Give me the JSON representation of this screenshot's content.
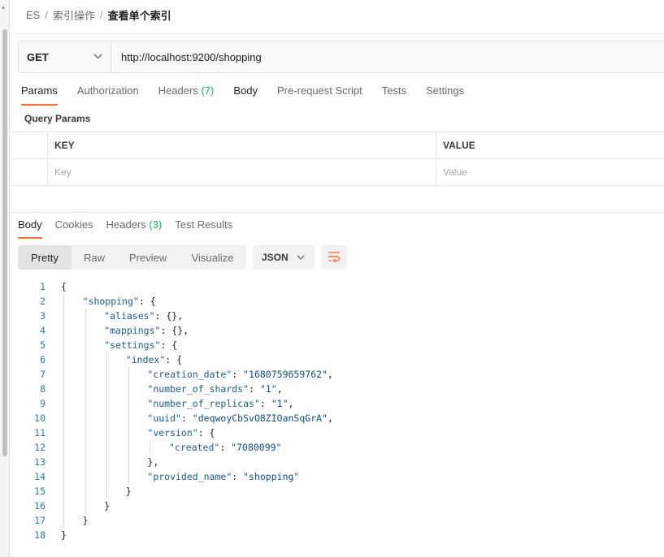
{
  "breadcrumb": {
    "items": [
      "ES",
      "索引操作"
    ],
    "current": "查看单个索引",
    "separator": "/"
  },
  "request": {
    "method": "GET",
    "url": "http://localhost:9200/shopping"
  },
  "request_tabs": {
    "params": "Params",
    "authorization": "Authorization",
    "headers": "Headers",
    "headers_count": "(7)",
    "body": "Body",
    "prerequest": "Pre-request Script",
    "tests": "Tests",
    "settings": "Settings"
  },
  "query_params": {
    "title": "Query Params",
    "col_key": "KEY",
    "col_value": "VALUE",
    "key_placeholder": "Key",
    "value_placeholder": "Value"
  },
  "response_tabs": {
    "body": "Body",
    "cookies": "Cookies",
    "headers": "Headers",
    "headers_count": "(3)",
    "test_results": "Test Results"
  },
  "view_modes": {
    "pretty": "Pretty",
    "raw": "Raw",
    "preview": "Preview",
    "visualize": "Visualize"
  },
  "format": "JSON",
  "colors": {
    "accent": "#ff6c37",
    "count": "#0cbb52",
    "line_number": "#2a7bb5"
  },
  "response_lines": [
    {
      "n": "1",
      "depth": 0,
      "parts": [
        {
          "t": "p",
          "v": "{"
        }
      ]
    },
    {
      "n": "2",
      "depth": 1,
      "parts": [
        {
          "t": "k",
          "v": "\"shopping\""
        },
        {
          "t": "p",
          "v": ": {"
        }
      ]
    },
    {
      "n": "3",
      "depth": 2,
      "parts": [
        {
          "t": "k",
          "v": "\"aliases\""
        },
        {
          "t": "p",
          "v": ": {},"
        }
      ]
    },
    {
      "n": "4",
      "depth": 2,
      "parts": [
        {
          "t": "k",
          "v": "\"mappings\""
        },
        {
          "t": "p",
          "v": ": {},"
        }
      ]
    },
    {
      "n": "5",
      "depth": 2,
      "parts": [
        {
          "t": "k",
          "v": "\"settings\""
        },
        {
          "t": "p",
          "v": ": {"
        }
      ]
    },
    {
      "n": "6",
      "depth": 3,
      "parts": [
        {
          "t": "k",
          "v": "\"index\""
        },
        {
          "t": "p",
          "v": ": {"
        }
      ]
    },
    {
      "n": "7",
      "depth": 4,
      "parts": [
        {
          "t": "k",
          "v": "\"creation_date\""
        },
        {
          "t": "p",
          "v": ": "
        },
        {
          "t": "s",
          "v": "\"1680759659762\""
        },
        {
          "t": "p",
          "v": ","
        }
      ]
    },
    {
      "n": "8",
      "depth": 4,
      "parts": [
        {
          "t": "k",
          "v": "\"number_of_shards\""
        },
        {
          "t": "p",
          "v": ": "
        },
        {
          "t": "s",
          "v": "\"1\""
        },
        {
          "t": "p",
          "v": ","
        }
      ]
    },
    {
      "n": "9",
      "depth": 4,
      "parts": [
        {
          "t": "k",
          "v": "\"number_of_replicas\""
        },
        {
          "t": "p",
          "v": ": "
        },
        {
          "t": "s",
          "v": "\"1\""
        },
        {
          "t": "p",
          "v": ","
        }
      ]
    },
    {
      "n": "10",
      "depth": 4,
      "parts": [
        {
          "t": "k",
          "v": "\"uuid\""
        },
        {
          "t": "p",
          "v": ": "
        },
        {
          "t": "s",
          "v": "\"deqwoyCbSvO8ZIOanSqGrA\""
        },
        {
          "t": "p",
          "v": ","
        }
      ]
    },
    {
      "n": "11",
      "depth": 4,
      "parts": [
        {
          "t": "k",
          "v": "\"version\""
        },
        {
          "t": "p",
          "v": ": {"
        }
      ]
    },
    {
      "n": "12",
      "depth": 5,
      "parts": [
        {
          "t": "k",
          "v": "\"created\""
        },
        {
          "t": "p",
          "v": ": "
        },
        {
          "t": "s",
          "v": "\"7080099\""
        }
      ]
    },
    {
      "n": "13",
      "depth": 4,
      "parts": [
        {
          "t": "p",
          "v": "},"
        }
      ]
    },
    {
      "n": "14",
      "depth": 4,
      "parts": [
        {
          "t": "k",
          "v": "\"provided_name\""
        },
        {
          "t": "p",
          "v": ": "
        },
        {
          "t": "s",
          "v": "\"shopping\""
        }
      ]
    },
    {
      "n": "15",
      "depth": 3,
      "parts": [
        {
          "t": "p",
          "v": "}"
        }
      ]
    },
    {
      "n": "16",
      "depth": 2,
      "parts": [
        {
          "t": "p",
          "v": "}"
        }
      ]
    },
    {
      "n": "17",
      "depth": 1,
      "parts": [
        {
          "t": "p",
          "v": "}"
        }
      ]
    },
    {
      "n": "18",
      "depth": 0,
      "parts": [
        {
          "t": "p",
          "v": "}"
        }
      ]
    }
  ]
}
